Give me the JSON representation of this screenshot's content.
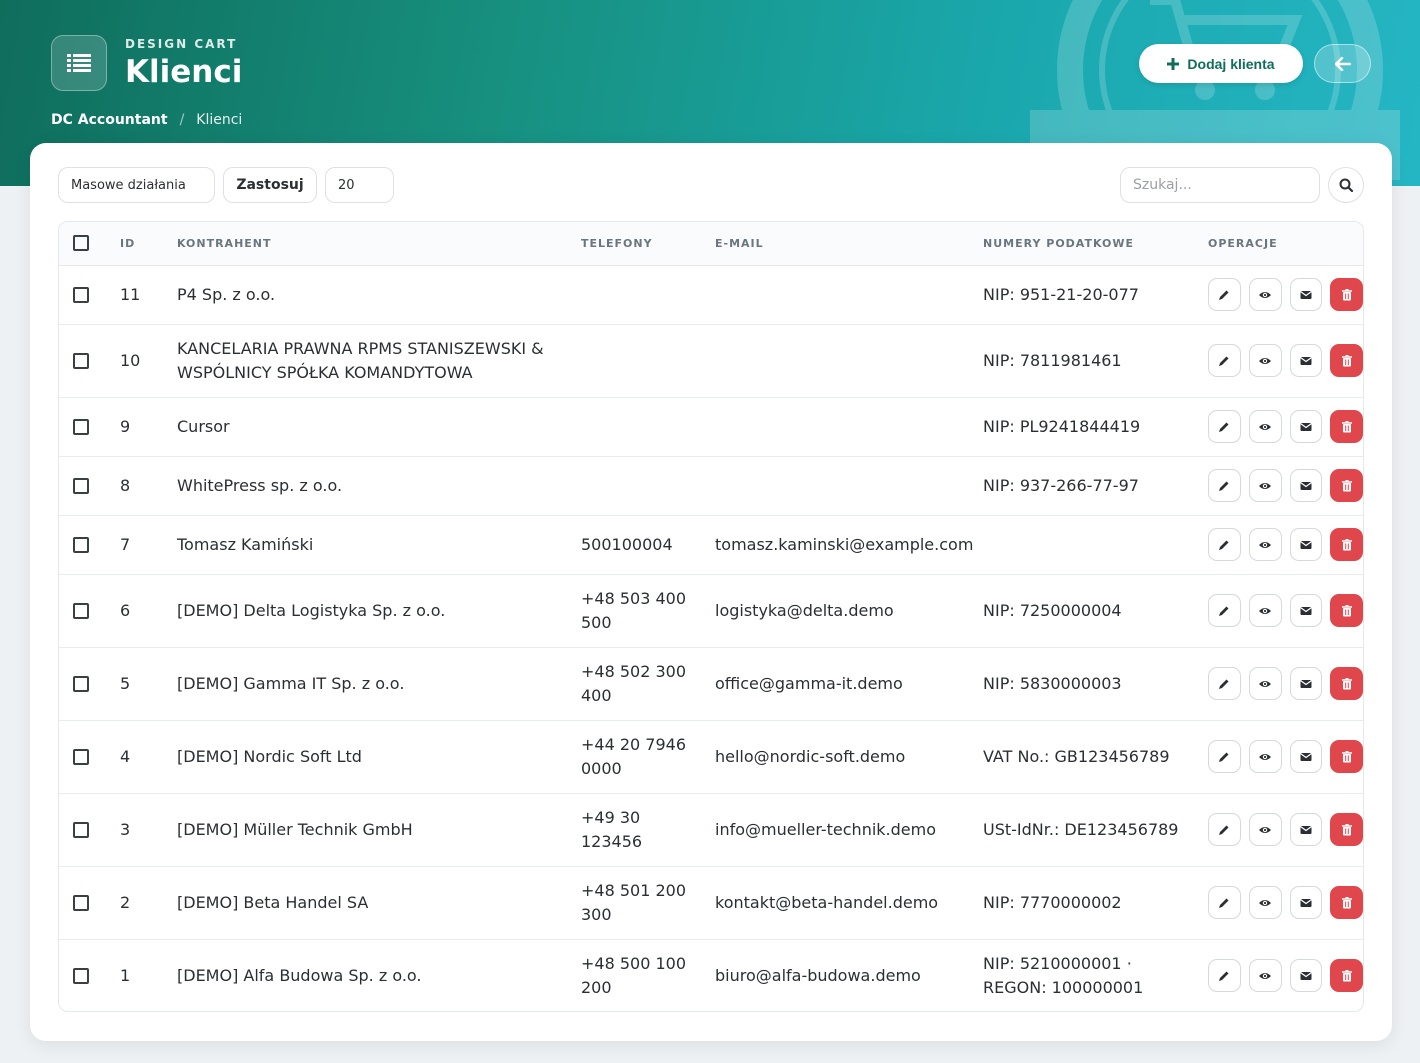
{
  "header": {
    "eyebrow": "DESIGN CART",
    "title": "Klienci",
    "breadcrumb": {
      "root": "DC Accountant",
      "separator": "/",
      "current": "Klienci"
    },
    "add_button": "Dodaj klienta",
    "accent": "#0f6d5c"
  },
  "toolbar": {
    "bulk_actions": "Masowe działania",
    "apply": "Zastosuj",
    "per_page": "20",
    "search_placeholder": "Szukaj..."
  },
  "table": {
    "columns": [
      "ID",
      "KONTRAHENT",
      "TELEFONY",
      "E-MAIL",
      "NUMERY PODATKOWE",
      "OPERACJE"
    ],
    "rows": [
      {
        "id": "11",
        "name": "P4 Sp. z o.o.",
        "phone": "",
        "email": "",
        "tax": "NIP: 951-21-20-077"
      },
      {
        "id": "10",
        "name": "KANCELARIA PRAWNA RPMS STANISZEWSKI & WSPÓLNICY SPÓŁKA KOMANDYTOWA",
        "phone": "",
        "email": "",
        "tax": "NIP: 7811981461"
      },
      {
        "id": "9",
        "name": "Cursor",
        "phone": "",
        "email": "",
        "tax": "NIP: PL9241844419"
      },
      {
        "id": "8",
        "name": "WhitePress sp. z o.o.",
        "phone": "",
        "email": "",
        "tax": "NIP: 937-266-77-97"
      },
      {
        "id": "7",
        "name": "Tomasz Kamiński",
        "phone": "500100004",
        "email": "tomasz.kaminski@example.com",
        "tax": ""
      },
      {
        "id": "6",
        "name": "[DEMO] Delta Logistyka Sp. z o.o.",
        "phone": "+48 503 400 500",
        "email": "logistyka@delta.demo",
        "tax": "NIP: 7250000004"
      },
      {
        "id": "5",
        "name": "[DEMO] Gamma IT Sp. z o.o.",
        "phone": "+48 502 300 400",
        "email": "office@gamma-it.demo",
        "tax": "NIP: 5830000003"
      },
      {
        "id": "4",
        "name": "[DEMO] Nordic Soft Ltd",
        "phone": "+44 20 7946 0000",
        "email": "hello@nordic-soft.demo",
        "tax": "VAT No.: GB123456789"
      },
      {
        "id": "3",
        "name": "[DEMO] Müller Technik GmbH",
        "phone": "+49 30 123456",
        "email": "info@mueller-technik.demo",
        "tax": "USt-IdNr.: DE123456789"
      },
      {
        "id": "2",
        "name": "[DEMO] Beta Handel SA",
        "phone": "+48 501 200 300",
        "email": "kontakt@beta-handel.demo",
        "tax": "NIP: 7770000002"
      },
      {
        "id": "1",
        "name": "[DEMO] Alfa Budowa Sp. z o.o.",
        "phone": "+48 500 100 200",
        "email": "biuro@alfa-budowa.demo",
        "tax": "NIP: 5210000001 · REGON: 100000001"
      }
    ],
    "row_operations": [
      "edit-icon",
      "eye-icon",
      "envelope-icon",
      "trash-icon"
    ],
    "delete_color": "#e0474c"
  }
}
